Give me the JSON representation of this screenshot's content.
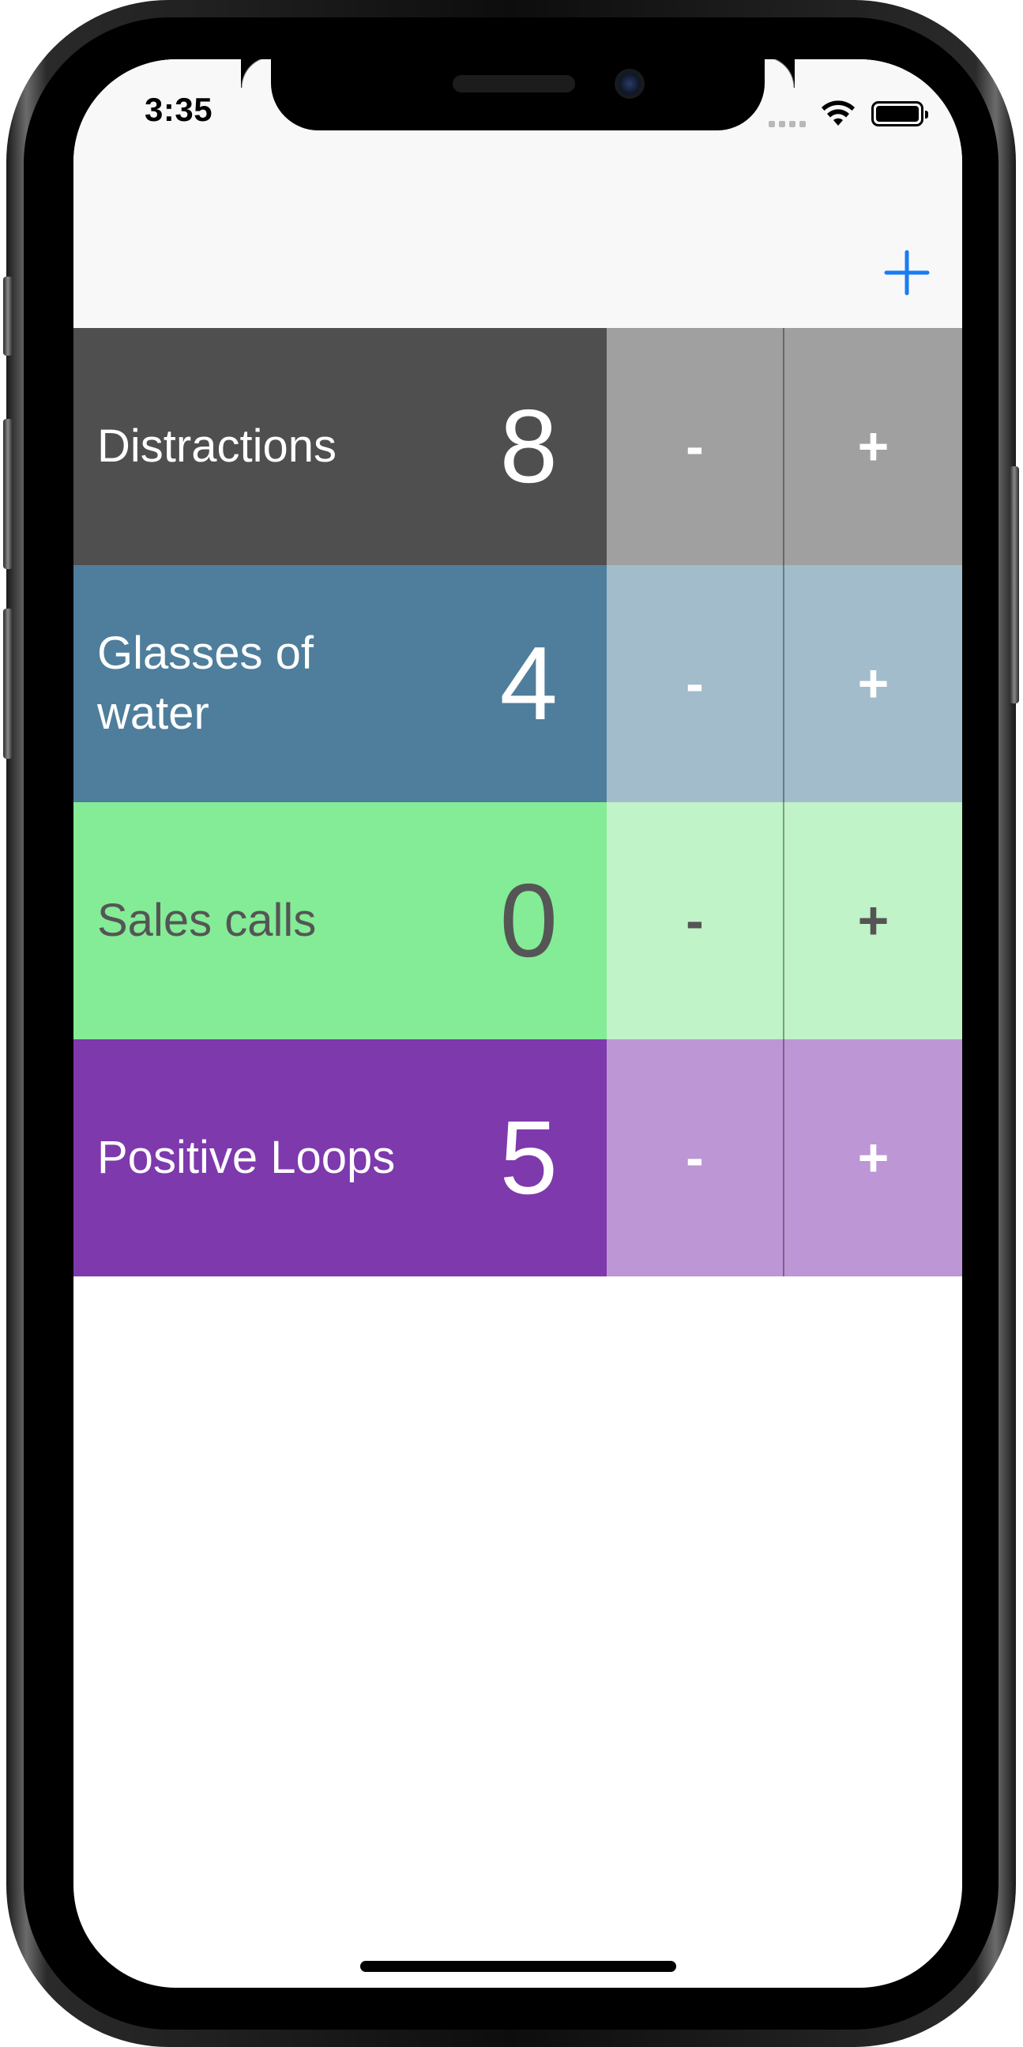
{
  "status": {
    "time": "3:35",
    "signal_icon": "cellular-signal-icon",
    "wifi_icon": "wifi-icon",
    "battery_icon": "battery-icon"
  },
  "navbar": {
    "add_icon": "plus-icon",
    "accent_color": "#1a7cf3"
  },
  "counters": [
    {
      "label": "Distractions",
      "count": "8",
      "decrement_label": "-",
      "increment_label": "+",
      "main_color": "#4f4f4f",
      "button_color": "#a0a0a0",
      "text_color": "#ffffff"
    },
    {
      "label": "Glasses of water",
      "count": "4",
      "decrement_label": "-",
      "increment_label": "+",
      "main_color": "#4e7e9c",
      "button_color": "#a2bccb",
      "text_color": "#ffffff"
    },
    {
      "label": "Sales calls",
      "count": "0",
      "decrement_label": "-",
      "increment_label": "+",
      "main_color": "#84eb96",
      "button_color": "#c0f3c8",
      "text_color": "#555555"
    },
    {
      "label": "Positive Loops",
      "count": "5",
      "decrement_label": "-",
      "increment_label": "+",
      "main_color": "#7e39ad",
      "button_color": "#bd96d5",
      "text_color": "#ffffff"
    }
  ]
}
